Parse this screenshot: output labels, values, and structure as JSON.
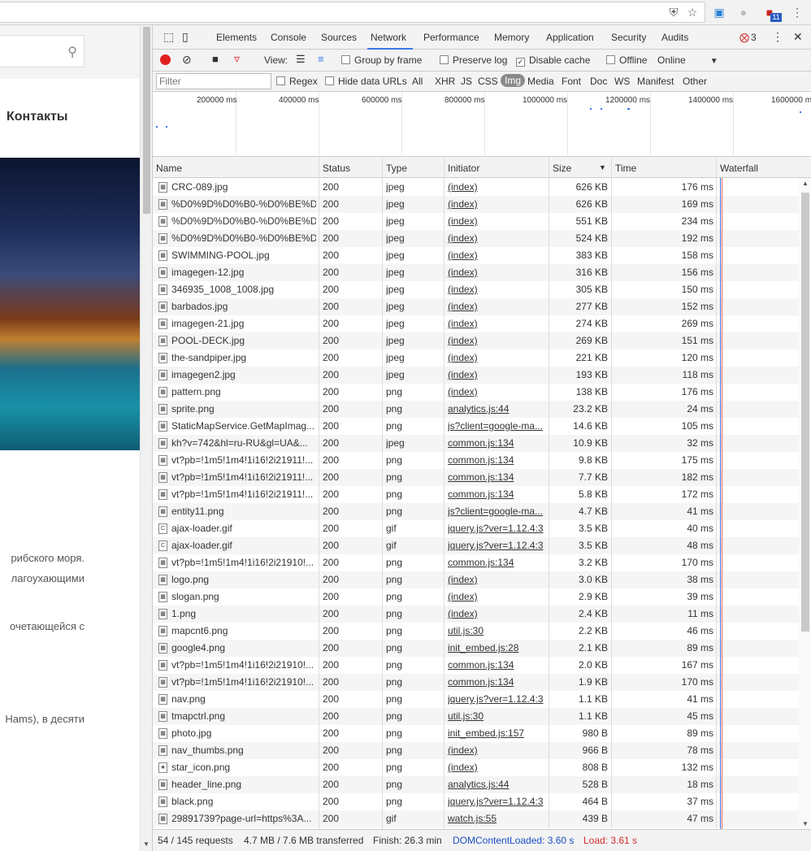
{
  "browser": {
    "icons": [
      "shield-icon",
      "star-icon",
      "extension-icon",
      "extension-icon",
      "extension-icon",
      "menu-icon"
    ],
    "badge": "11"
  },
  "page": {
    "contacts": "Контакты",
    "lines": [
      "рибского моря.",
      "лагоухающими",
      "очетающейся с",
      "Hams), в десяти"
    ]
  },
  "tabs": [
    "Elements",
    "Console",
    "Sources",
    "Network",
    "Performance",
    "Memory",
    "Application",
    "Security",
    "Audits"
  ],
  "errors": "3",
  "toolbar": {
    "view": "View:",
    "group_by_frame": "Group by frame",
    "preserve_log": "Preserve log",
    "disable_cache": "Disable cache",
    "offline": "Offline",
    "throttle": "Online"
  },
  "filter": {
    "placeholder": "Filter",
    "regex": "Regex",
    "hide_data_urls": "Hide data URLs",
    "types": [
      "All",
      "XHR",
      "JS",
      "CSS",
      "Img",
      "Media",
      "Font",
      "Doc",
      "WS",
      "Manifest",
      "Other"
    ]
  },
  "overview": {
    "ticks": [
      "200000 ms",
      "400000 ms",
      "600000 ms",
      "800000 ms",
      "1000000 ms",
      "1200000 ms",
      "1400000 ms",
      "1600000 m"
    ]
  },
  "columns": {
    "name": "Name",
    "status": "Status",
    "type": "Type",
    "initiator": "Initiator",
    "size": "Size",
    "time": "Time",
    "waterfall": "Waterfall"
  },
  "rows": [
    {
      "icon": "img-icon",
      "name": "CRC-089.jpg",
      "status": "200",
      "type": "jpeg",
      "initiator": "(index)",
      "size": "626 KB",
      "time": "176 ms"
    },
    {
      "icon": "img-icon",
      "name": "%D0%9D%D0%B0-%D0%BE%D...",
      "status": "200",
      "type": "jpeg",
      "initiator": "(index)",
      "size": "626 KB",
      "time": "169 ms"
    },
    {
      "icon": "img-icon",
      "name": "%D0%9D%D0%B0-%D0%BE%D...",
      "status": "200",
      "type": "jpeg",
      "initiator": "(index)",
      "size": "551 KB",
      "time": "234 ms"
    },
    {
      "icon": "img-icon",
      "name": "%D0%9D%D0%B0-%D0%BE%D...",
      "status": "200",
      "type": "jpeg",
      "initiator": "(index)",
      "size": "524 KB",
      "time": "192 ms"
    },
    {
      "icon": "img-icon",
      "name": "SWIMMING-POOL.jpg",
      "status": "200",
      "type": "jpeg",
      "initiator": "(index)",
      "size": "383 KB",
      "time": "158 ms"
    },
    {
      "icon": "img-icon",
      "name": "imagegen-12.jpg",
      "status": "200",
      "type": "jpeg",
      "initiator": "(index)",
      "size": "316 KB",
      "time": "156 ms"
    },
    {
      "icon": "img-icon",
      "name": "346935_1008_1008.jpg",
      "status": "200",
      "type": "jpeg",
      "initiator": "(index)",
      "size": "305 KB",
      "time": "150 ms"
    },
    {
      "icon": "img-icon",
      "name": "barbados.jpg",
      "status": "200",
      "type": "jpeg",
      "initiator": "(index)",
      "size": "277 KB",
      "time": "152 ms"
    },
    {
      "icon": "img-icon",
      "name": "imagegen-21.jpg",
      "status": "200",
      "type": "jpeg",
      "initiator": "(index)",
      "size": "274 KB",
      "time": "269 ms"
    },
    {
      "icon": "img-icon",
      "name": "POOL-DECK.jpg",
      "status": "200",
      "type": "jpeg",
      "initiator": "(index)",
      "size": "269 KB",
      "time": "151 ms"
    },
    {
      "icon": "img-icon",
      "name": "the-sandpiper.jpg",
      "status": "200",
      "type": "jpeg",
      "initiator": "(index)",
      "size": "221 KB",
      "time": "120 ms"
    },
    {
      "icon": "img-icon",
      "name": "imagegen2.jpg",
      "status": "200",
      "type": "jpeg",
      "initiator": "(index)",
      "size": "193 KB",
      "time": "118 ms"
    },
    {
      "icon": "img-icon",
      "name": "pattern.png",
      "status": "200",
      "type": "png",
      "initiator": "(index)",
      "size": "138 KB",
      "time": "176 ms"
    },
    {
      "icon": "img-icon",
      "name": "sprite.png",
      "status": "200",
      "type": "png",
      "initiator": "analytics.js:44",
      "size": "23.2 KB",
      "time": "24 ms"
    },
    {
      "icon": "img-icon",
      "name": "StaticMapService.GetMapImag...",
      "status": "200",
      "type": "png",
      "initiator": "js?client=google-ma...",
      "size": "14.6 KB",
      "time": "105 ms"
    },
    {
      "icon": "img-icon",
      "name": "kh?v=742&hl=ru-RU&gl=UA&...",
      "status": "200",
      "type": "jpeg",
      "initiator": "common.js:134",
      "size": "10.9 KB",
      "time": "32 ms"
    },
    {
      "icon": "img-icon",
      "name": "vt?pb=!1m5!1m4!1i16!2i21911!...",
      "status": "200",
      "type": "png",
      "initiator": "common.js:134",
      "size": "9.8 KB",
      "time": "175 ms"
    },
    {
      "icon": "img-icon",
      "name": "vt?pb=!1m5!1m4!1i16!2i21911!...",
      "status": "200",
      "type": "png",
      "initiator": "common.js:134",
      "size": "7.7 KB",
      "time": "182 ms"
    },
    {
      "icon": "img-icon",
      "name": "vt?pb=!1m5!1m4!1i16!2i21911!...",
      "status": "200",
      "type": "png",
      "initiator": "common.js:134",
      "size": "5.8 KB",
      "time": "172 ms"
    },
    {
      "icon": "img-icon",
      "name": "entity11.png",
      "status": "200",
      "type": "png",
      "initiator": "js?client=google-ma...",
      "size": "4.7 KB",
      "time": "41 ms"
    },
    {
      "icon": "gif-icon",
      "name": "ajax-loader.gif",
      "status": "200",
      "type": "gif",
      "initiator": "jquery.js?ver=1.12.4:3",
      "size": "3.5 KB",
      "time": "40 ms"
    },
    {
      "icon": "gif-icon",
      "name": "ajax-loader.gif",
      "status": "200",
      "type": "gif",
      "initiator": "jquery.js?ver=1.12.4:3",
      "size": "3.5 KB",
      "time": "48 ms"
    },
    {
      "icon": "img-icon",
      "name": "vt?pb=!1m5!1m4!1i16!2i21910!...",
      "status": "200",
      "type": "png",
      "initiator": "common.js:134",
      "size": "3.2 KB",
      "time": "170 ms"
    },
    {
      "icon": "img-icon",
      "name": "logo.png",
      "status": "200",
      "type": "png",
      "initiator": "(index)",
      "size": "3.0 KB",
      "time": "38 ms"
    },
    {
      "icon": "img-icon",
      "name": "slogan.png",
      "status": "200",
      "type": "png",
      "initiator": "(index)",
      "size": "2.9 KB",
      "time": "39 ms"
    },
    {
      "icon": "img-icon",
      "name": "1.png",
      "status": "200",
      "type": "png",
      "initiator": "(index)",
      "size": "2.4 KB",
      "time": "11 ms"
    },
    {
      "icon": "img-icon",
      "name": "mapcnt6.png",
      "status": "200",
      "type": "png",
      "initiator": "util.js:30",
      "size": "2.2 KB",
      "time": "46 ms"
    },
    {
      "icon": "img-icon",
      "name": "google4.png",
      "status": "200",
      "type": "png",
      "initiator": "init_embed.js:28",
      "size": "2.1 KB",
      "time": "89 ms"
    },
    {
      "icon": "img-icon",
      "name": "vt?pb=!1m5!1m4!1i16!2i21910!...",
      "status": "200",
      "type": "png",
      "initiator": "common.js:134",
      "size": "2.0 KB",
      "time": "167 ms"
    },
    {
      "icon": "img-icon",
      "name": "vt?pb=!1m5!1m4!1i16!2i21910!...",
      "status": "200",
      "type": "png",
      "initiator": "common.js:134",
      "size": "1.9 KB",
      "time": "170 ms"
    },
    {
      "icon": "img-icon",
      "name": "nav.png",
      "status": "200",
      "type": "png",
      "initiator": "jquery.js?ver=1.12.4:3",
      "size": "1.1 KB",
      "time": "41 ms"
    },
    {
      "icon": "img-icon",
      "name": "tmapctrl.png",
      "status": "200",
      "type": "png",
      "initiator": "util.js:30",
      "size": "1.1 KB",
      "time": "45 ms"
    },
    {
      "icon": "img-icon",
      "name": "photo.jpg",
      "status": "200",
      "type": "png",
      "initiator": "init_embed.js:157",
      "size": "980 B",
      "time": "89 ms"
    },
    {
      "icon": "img-icon",
      "name": "nav_thumbs.png",
      "status": "200",
      "type": "png",
      "initiator": "(index)",
      "size": "966 B",
      "time": "78 ms"
    },
    {
      "icon": "star-icon",
      "name": "star_icon.png",
      "status": "200",
      "type": "png",
      "initiator": "(index)",
      "size": "808 B",
      "time": "132 ms"
    },
    {
      "icon": "img-icon",
      "name": "header_line.png",
      "status": "200",
      "type": "png",
      "initiator": "analytics.js:44",
      "size": "528 B",
      "time": "18 ms"
    },
    {
      "icon": "img-icon",
      "name": "black.png",
      "status": "200",
      "type": "png",
      "initiator": "jquery.js?ver=1.12.4:3",
      "size": "464 B",
      "time": "37 ms"
    },
    {
      "icon": "img-icon",
      "name": "29891739?page-url=https%3A...",
      "status": "200",
      "type": "gif",
      "initiator": "watch.js:55",
      "size": "439 B",
      "time": "47 ms"
    }
  ],
  "status": {
    "requests": "54 / 145 requests",
    "transferred": "4.7 MB / 7.6 MB transferred",
    "finish": "Finish: 26.3 min",
    "dom": "DOMContentLoaded: 3.60 s",
    "load": "Load: 3.61 s"
  },
  "colors": {
    "accent": "#3b78e7",
    "dom": "#1a4fc4",
    "load": "#d32f2f",
    "record": "#e0201e"
  }
}
